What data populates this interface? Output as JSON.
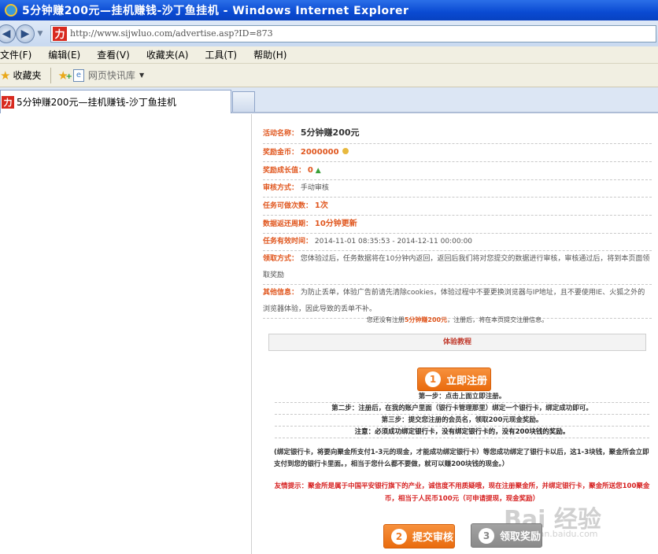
{
  "window": {
    "title": "5分钟赚200元—挂机赚钱-沙丁鱼挂机 - Windows Internet Explorer"
  },
  "address": {
    "url": "http://www.sijwluo.com/advertise.asp?ID=873",
    "site_icon_char": "力"
  },
  "menu": {
    "items": [
      "文件(F)",
      "编辑(E)",
      "查看(V)",
      "收藏夹(A)",
      "工具(T)",
      "帮助(H)"
    ]
  },
  "favorites": {
    "label": "收藏夹",
    "quicklib": "网页快讯库"
  },
  "tabs": {
    "active_label": "5分钟赚200元—挂机赚钱-沙丁鱼挂机"
  },
  "task": {
    "name_label": "活动名称：",
    "name_value": "5分钟赚200元",
    "reward_label": "奖励金币：",
    "reward_value": "2000000",
    "growth_label": "奖励成长值：",
    "growth_value": "0",
    "audit_label": "审核方式：",
    "audit_value": "手动审核",
    "times_label": "任务可做次数：",
    "times_value": "1次",
    "cycle_label": "数据返还周期：",
    "cycle_value": "10分钟更新",
    "period_label": "任务有效时间：",
    "period_value": "2014-11-01 08:35:53 - 2014-12-11 00:00:00",
    "method_label": "领取方式：",
    "method_value": "您体验过后，任务数据将在10分钟内返回，返回后我们将对您提交的数据进行审核，审核通过后，将到本页面领取奖励",
    "other_label": "其他信息：",
    "other_value": "为防止丢单，体验广告前请先清除cookies，体验过程中不要更换浏览器与IP地址，且不要使用IE、火狐之外的浏览器体验，因此导致的丢单不补。"
  },
  "notice": {
    "prefix": "您还没有注册",
    "highlight": "5分钟赚200元",
    "suffix": "，注册后，将在本页提交注册信息。"
  },
  "tutorial": {
    "label": "体验教程"
  },
  "buttons": {
    "register": "立即注册",
    "register_num": "1",
    "submit": "提交审核",
    "submit_num": "2",
    "claim": "领取奖励",
    "claim_num": "3"
  },
  "steps": {
    "s1": "第一步：点击上面立即注册。",
    "s2": "第二步：注册后，在我的账户里面（银行卡管理那里）绑定一个银行卡，绑定成功即可。",
    "s3": "第三步：提交您注册的会员名，领取200元现金奖励。",
    "s4": "注意：必须成功绑定银行卡，没有绑定银行卡的，没有200块钱的奖励。"
  },
  "explain": "(绑定银行卡，将要向聚金所支付1-3元的现金，才能成功绑定银行卡）等您成功绑定了银行卡以后，这1-3块钱，聚金所会立即支付到您的银行卡里面。，相当于您什么都不要做，就可以赚200块钱的现金。）",
  "warm": {
    "text": "友情提示：聚金所是属于中国平安银行旗下的产业，诚信度不用质疑哦，现在注册聚金所，并绑定银行卡，聚金所送您100聚金币，相当于人民币100元（可申请提现，现金奖励）"
  },
  "watermark": {
    "main": "Bai 经验",
    "sub": "jingyan.baidu.com"
  },
  "colors": {
    "accent": "#e0571f",
    "button_orange": "#ef7a21",
    "button_gray": "#8a8a8a",
    "warning_red": "#d61e1e"
  }
}
